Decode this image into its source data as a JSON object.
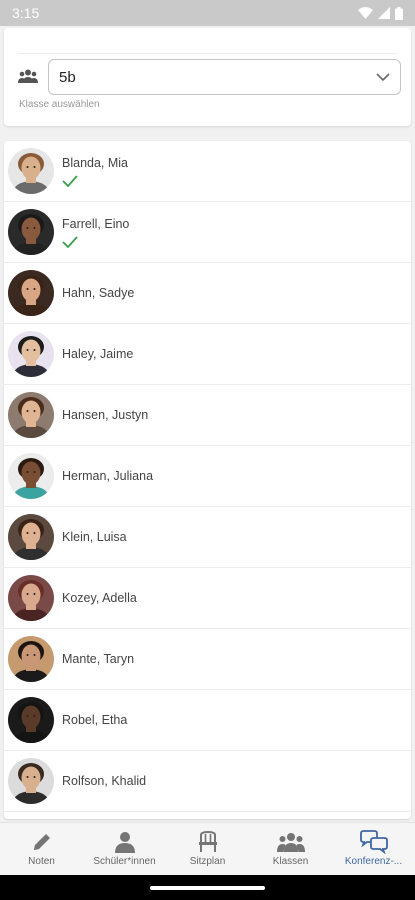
{
  "status_bar": {
    "time": "3:15"
  },
  "class_selector": {
    "value": "5b",
    "hint": "Klasse auswählen"
  },
  "students": [
    {
      "name": "Blanda, Mia",
      "checked": true,
      "skin": "#d9b08c",
      "hair": "#8a5a3b",
      "bg": "#e6e6e6",
      "shirt": "#6b6b6b"
    },
    {
      "name": "Farrell, Eino",
      "checked": true,
      "skin": "#8a5a3e",
      "hair": "#1a1a1a",
      "bg": "#2a2a2a",
      "shirt": "#222222"
    },
    {
      "name": "Hahn, Sadye",
      "checked": false,
      "skin": "#d8a585",
      "hair": "#3a2418",
      "bg": "#3a2a22",
      "shirt": "#3a2418"
    },
    {
      "name": "Haley, Jaime",
      "checked": false,
      "skin": "#e3bfa0",
      "hair": "#1c1c1c",
      "bg": "#e8e2ef",
      "shirt": "#2d2d3a"
    },
    {
      "name": "Hansen, Justyn",
      "checked": false,
      "skin": "#e0b594",
      "hair": "#4a2c1a",
      "bg": "#8c7b6e",
      "shirt": "#5a4a40"
    },
    {
      "name": "Herman, Juliana",
      "checked": false,
      "skin": "#7a4e34",
      "hair": "#2a1a12",
      "bg": "#ececec",
      "shirt": "#3ba3a0"
    },
    {
      "name": "Klein, Luisa",
      "checked": false,
      "skin": "#ddb192",
      "hair": "#3b2216",
      "bg": "#5c4a40",
      "shirt": "#2f2f2f"
    },
    {
      "name": "Kozey, Adella",
      "checked": false,
      "skin": "#d9a98e",
      "hair": "#6a2e2a",
      "bg": "#7a4a48",
      "shirt": "#4a2422"
    },
    {
      "name": "Mante, Taryn",
      "checked": false,
      "skin": "#c99676",
      "hair": "#1e1410",
      "bg": "#c49a6e",
      "shirt": "#1a1a1a"
    },
    {
      "name": "Robel, Etha",
      "checked": false,
      "skin": "#5a3a28",
      "hair": "#141414",
      "bg": "#1a1a1a",
      "shirt": "#141414"
    },
    {
      "name": "Rolfson, Khalid",
      "checked": false,
      "skin": "#d8b08e",
      "hair": "#3a2a20",
      "bg": "#dcdcdc",
      "shirt": "#2c2c2c"
    }
  ],
  "bottom_nav": [
    {
      "label": "Noten",
      "icon": "pencil-icon",
      "active": false
    },
    {
      "label": "Schüler*innen",
      "icon": "person-icon",
      "active": false
    },
    {
      "label": "Sitzplan",
      "icon": "chair-icon",
      "active": false
    },
    {
      "label": "Klassen",
      "icon": "group-icon",
      "active": false
    },
    {
      "label": "Konferenz-...",
      "icon": "chat-bubbles-icon",
      "active": true
    }
  ],
  "colors": {
    "accent": "#3f67a3",
    "check": "#3aa14a",
    "nav_icon": "#757575"
  }
}
